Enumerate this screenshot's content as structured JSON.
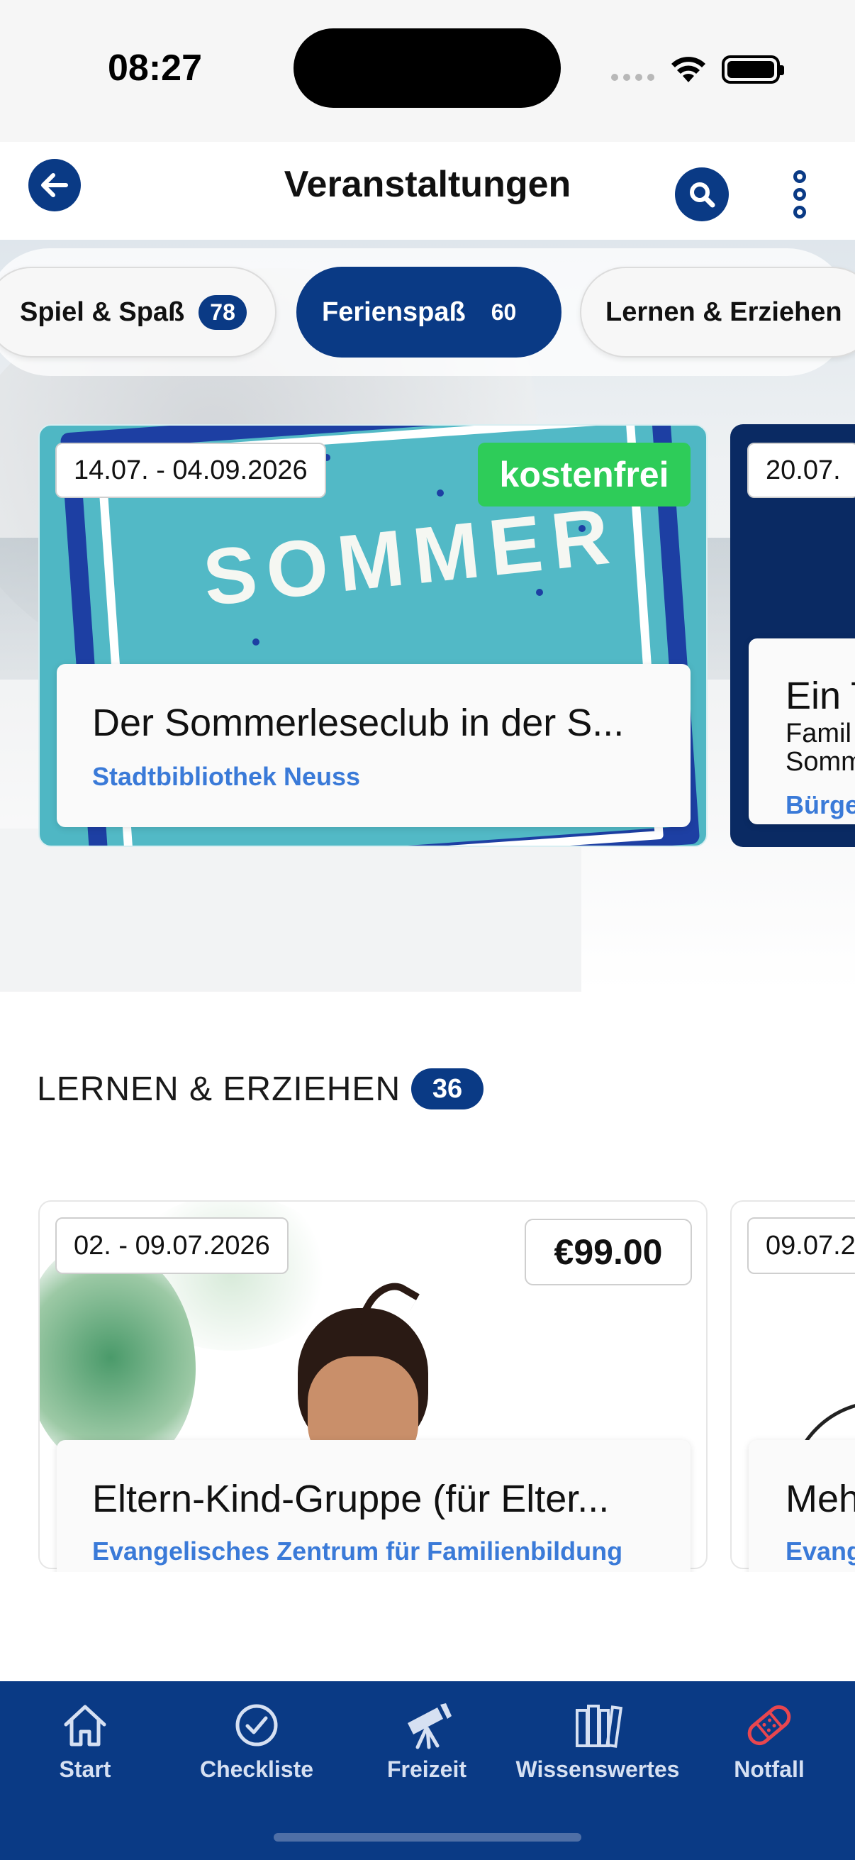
{
  "status": {
    "time": "08:27"
  },
  "nav": {
    "title": "Veranstaltungen"
  },
  "filters": [
    {
      "label": "Spiel & Spaß",
      "count": "78",
      "active": false
    },
    {
      "label": "Ferienspaß",
      "count": "60",
      "active": true
    },
    {
      "label": "Lernen & Erziehen",
      "count": "",
      "active": false
    }
  ],
  "ferien_cards": [
    {
      "date": "14.07. - 04.09.2026",
      "tag": "kostenfrei",
      "title": "Der Sommerleseclub in der S...",
      "organizer": "Stadtbibliothek Neuss"
    },
    {
      "date": "20.07.",
      "title": "Ein T",
      "subtitle_lines": [
        "Famil",
        "Somm"
      ],
      "organizer": "Bürge"
    }
  ],
  "section": {
    "title": "LERNEN & ERZIEHEN",
    "count": "36"
  },
  "lernen_cards": [
    {
      "date": "02. - 09.07.2026",
      "price": "€99.00",
      "title": "Eltern-Kind-Gruppe (für Elter...",
      "organizer": "Evangelisches Zentrum für Familienbildung"
    },
    {
      "date": "09.07.2",
      "title": "Meh",
      "organizer": "Evang"
    }
  ],
  "bottom_nav": [
    {
      "label": "Start",
      "icon": "home-icon"
    },
    {
      "label": "Checkliste",
      "icon": "checkmark-circle-icon"
    },
    {
      "label": "Freizeit",
      "icon": "telescope-icon"
    },
    {
      "label": "Wissenswertes",
      "icon": "books-icon"
    },
    {
      "label": "Notfall",
      "icon": "bandage-icon"
    }
  ],
  "colors": {
    "primary": "#0a3a85",
    "free_tag": "#2ecc59",
    "organizer": "#3a7ad8",
    "notfall_icon": "#e8464f"
  }
}
